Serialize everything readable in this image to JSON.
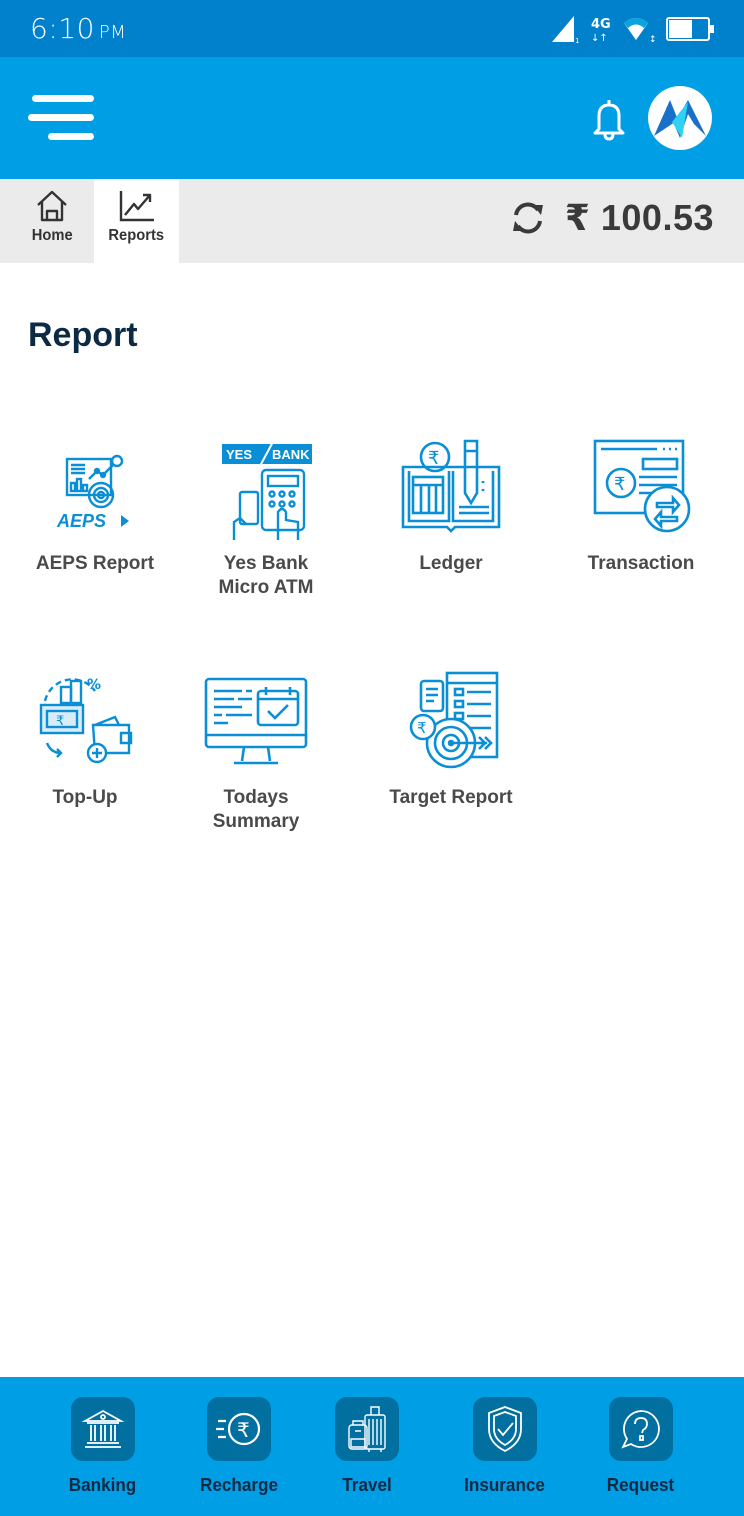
{
  "status_bar": {
    "time": "6:10",
    "ampm": "PM",
    "network": "4G",
    "icons": [
      "signal-icon",
      "network-4g-icon",
      "wifi-icon",
      "battery-icon"
    ]
  },
  "app_bar": {
    "menu_icon": "hamburger-menu-icon",
    "notification_icon": "bell-icon",
    "logo": "brand-logo"
  },
  "sub_bar": {
    "tabs": [
      {
        "label": "Home",
        "icon": "home-icon",
        "active": false
      },
      {
        "label": "Reports",
        "icon": "chart-trend-icon",
        "active": true
      }
    ],
    "refresh_icon": "refresh-icon",
    "currency_symbol": "₹",
    "balance": "100.53"
  },
  "page": {
    "title": "Report"
  },
  "reports": [
    {
      "label": "AEPS Report",
      "icon": "aeps-report-icon"
    },
    {
      "label": "Yes Bank\nMicro ATM",
      "line1": "Yes Bank",
      "line2": "Micro ATM",
      "icon": "yes-bank-micro-atm-icon",
      "badge_left": "YES",
      "badge_right": "BANK"
    },
    {
      "label": "Ledger",
      "icon": "ledger-icon"
    },
    {
      "label": "Transaction",
      "icon": "transaction-icon"
    },
    {
      "label": "Top-Up",
      "icon": "top-up-icon"
    },
    {
      "label": "Todays\nSummary",
      "line1": "Todays",
      "line2": "Summary",
      "icon": "todays-summary-icon"
    },
    {
      "label": "Target Report",
      "icon": "target-report-icon"
    }
  ],
  "aeps_logo_text": "AEPS",
  "bottom_nav": [
    {
      "label": "Banking",
      "icon": "bank-icon"
    },
    {
      "label": "Recharge",
      "icon": "rupee-recharge-icon"
    },
    {
      "label": "Travel",
      "icon": "luggage-icon"
    },
    {
      "label": "Insurance",
      "icon": "shield-check-icon"
    },
    {
      "label": "Request",
      "icon": "help-chat-icon"
    }
  ],
  "colors": {
    "status_bar": "#0180cc",
    "app_bar": "#009ee5",
    "sub_bar": "#ebebeb",
    "icon_blue": "#0a8fd6",
    "title": "#0d2a45",
    "nav_tile": "#016fa0"
  }
}
